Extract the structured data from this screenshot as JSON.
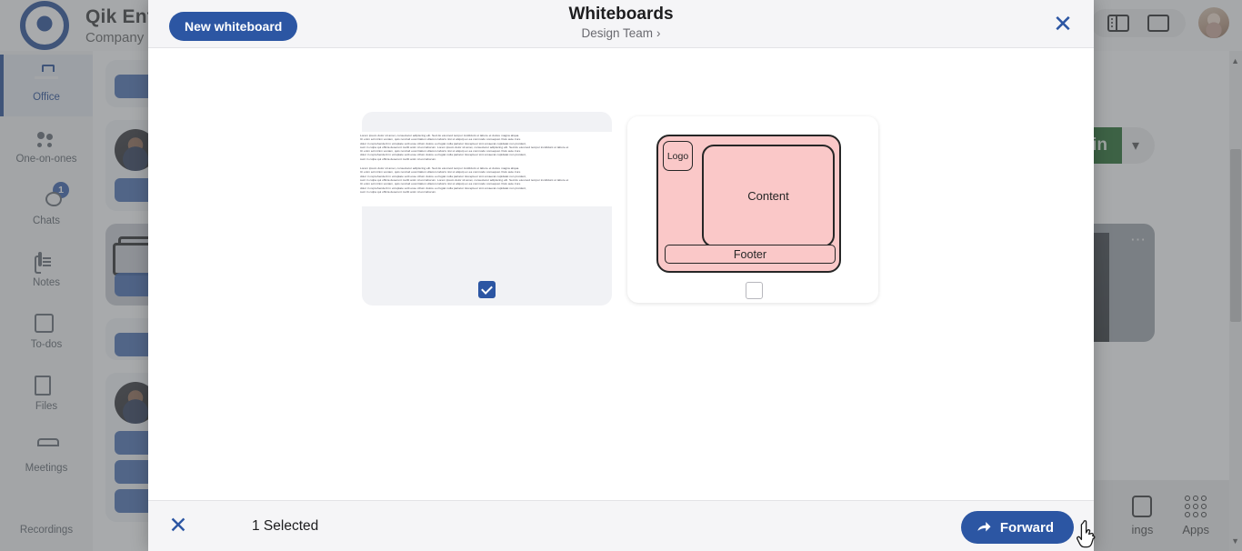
{
  "app": {
    "brand_title": "Qik Enterprise",
    "brand_subtitle": "Company - ",
    "logo_icon": "qik-logo-icon",
    "sidebar": [
      {
        "label": "Office",
        "icon": "briefcase-icon",
        "active": true,
        "badge": ""
      },
      {
        "label": "One-on-ones",
        "icon": "people-icon",
        "active": false,
        "badge": ""
      },
      {
        "label": "Chats",
        "icon": "chat-bubble-icon",
        "active": false,
        "badge": "1"
      },
      {
        "label": "Notes",
        "icon": "notes-icon",
        "active": false,
        "badge": ""
      },
      {
        "label": "To-dos",
        "icon": "checklist-icon",
        "active": false,
        "badge": ""
      },
      {
        "label": "Files",
        "icon": "files-icon",
        "active": false,
        "badge": ""
      },
      {
        "label": "Meetings",
        "icon": "meetings-icon",
        "active": false,
        "badge": ""
      },
      {
        "label": "Recordings",
        "icon": "recordings-icon",
        "active": false,
        "badge": ""
      }
    ],
    "topbar": {
      "split_pane_icon": "split-pane-icon",
      "single_pane_icon": "single-pane-icon",
      "avatar": "user-avatar"
    },
    "meeting": {
      "join_label": "Join",
      "join_icon": "join-icon",
      "join_chevron": "chevron-down-icon",
      "video_menu_icon": "more-options-icon"
    },
    "bottom_bar": [
      {
        "label": "ings",
        "icon": "settings-icon"
      },
      {
        "label": "Apps",
        "icon": "apps-grid-icon"
      }
    ],
    "scrollbar": {
      "up_arrow": "▲",
      "down_arrow": "▼"
    }
  },
  "modal": {
    "new_whiteboard_label": "New whiteboard",
    "title": "Whiteboards",
    "subtitle": "Design Team",
    "subtitle_chevron": "›",
    "close_icon": "close-icon",
    "close_glyph": "✕",
    "whiteboards": [
      {
        "id": "wb-text",
        "type": "text-document",
        "checked": true,
        "checkbox_icon": "checkbox-checked-icon",
        "paragraphs": [
          "Lorem ipsum dolor sit amet, consectetur adipiscing elit. Sed do eiusmod tempor incididunt ut labore et dolore magna aliqua.",
          "Ut enim ad minim veniam, quis nostrud exercitation ullamco laboris nisi ut aliquip ex ea commodo consequat. Duis aute irure",
          "dolor in reprehenderit in voluptate velit esse cillum dolore eu fugiat nulla pariatur. Excepteur sint occaecat cupidatat non proident,",
          "sunt in culpa qui officia deserunt mollit anim id est laborum. Lorem ipsum dolor sit amet, consectetur adipiscing elit. Sed do eiusmod tempor incididunt ut labore et",
          "Ut enim ad minim veniam, quis nostrud exercitation ullamco laboris nisi ut aliquip ex ea commodo consequat. Duis aute irure",
          "dolor in reprehenderit in voluptate velit esse cillum dolore eu fugiat nulla pariatur. Excepteur sint occaecat cupidatat non proident,",
          "sunt in culpa qui officia deserunt mollit anim id est laborum."
        ],
        "paragraphs2": [
          "Lorem ipsum dolor sit amet, consectetur adipiscing elit. Sed do eiusmod tempor incididunt ut labore et dolore magna aliqua.",
          "Ut enim ad minim veniam, quis nostrud exercitation ullamco laboris nisi ut aliquip ex ea commodo consequat. Duis aute irure",
          "dolor in reprehenderit in voluptate velit esse cillum dolore eu fugiat nulla pariatur. Excepteur sint occaecat cupidatat non proident,",
          "sunt in culpa qui officia deserunt mollit anim id est laborum. Lorem ipsum dolor sit amet, consectetur adipiscing elit. Sed do eiusmod tempor incididunt ut labore et",
          "Ut enim ad minim veniam, quis nostrud exercitation ullamco laboris nisi ut aliquip ex ea commodo consequat. Duis aute irure",
          "dolor in reprehenderit in voluptate velit esse cillum dolore eu fugiat nulla pariatur. Excepteur sint occaecat cupidatat non proident,",
          "sunt in culpa qui officia deserunt mollit anim id est laborum."
        ]
      },
      {
        "id": "wb-wireframe",
        "type": "wireframe",
        "checked": false,
        "checkbox_icon": "checkbox-unchecked-icon",
        "shapes": {
          "logo_label": "Logo",
          "content_label": "Content",
          "footer_label": "Footer",
          "fill_color": "#fac8c8",
          "stroke_color": "#262626"
        }
      }
    ],
    "footer": {
      "close_icon": "close-icon",
      "close_glyph": "✕",
      "selected_count_label": "1 Selected",
      "forward_label": "Forward",
      "forward_icon": "forward-arrow-icon"
    }
  },
  "colors": {
    "brand_blue": "#2c56a3",
    "deep_blue": "#18418f",
    "join_green": "#13601b",
    "wireframe_pink": "#fac8c8",
    "header_bg": "#f5f5f7"
  },
  "cursor": {
    "type": "pointing-hand-cursor"
  }
}
